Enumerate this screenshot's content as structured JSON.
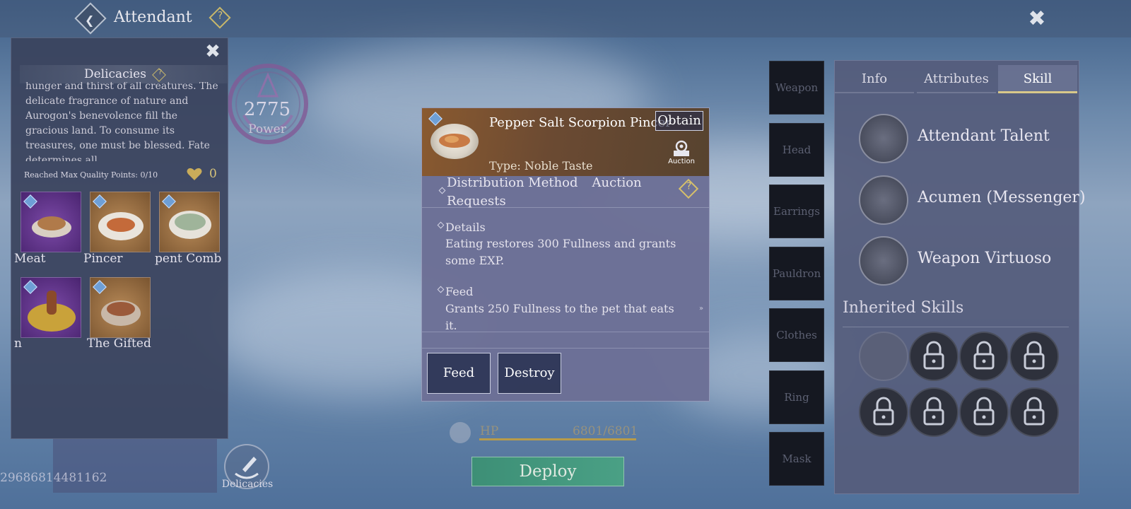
{
  "header": {
    "title": "Attendant",
    "help_symbol": "?"
  },
  "delicacies_panel": {
    "title": "Delicacies",
    "description": "hunger and thirst of all creatures. The delicate fragrance of nature and Aurogon's benevolence fill the gracious land. To consume its treasures, one must be blessed. Fate determines all",
    "quality_text": "Reached Max Quality Points: 0/10",
    "heart_count": "0",
    "items": [
      {
        "label": "Meat",
        "rarity": "purple",
        "icon": "food-icon"
      },
      {
        "label": "Pincer",
        "rarity": "gold",
        "icon": "food-icon"
      },
      {
        "label": "pent Comb",
        "rarity": "gold",
        "icon": "food-icon"
      },
      {
        "label": "n",
        "rarity": "purple",
        "icon": "food-icon"
      },
      {
        "label": "The Gifted",
        "rarity": "gold",
        "icon": "food-icon"
      }
    ]
  },
  "power": {
    "value": "2775",
    "label": "Power"
  },
  "account_id": "29686814481162",
  "delicacies_button_label": "Delicacies",
  "item_popup": {
    "name": "Pepper Salt Scorpion Pincer",
    "obtain_label": "Obtain",
    "type_text": "Type: Noble Taste",
    "auction_label": "Auction",
    "distribution_label": "Distribution Method",
    "distribution_value": "Auction",
    "requests_label": "Requests",
    "details_heading": "Details",
    "details_text": "Eating restores 300 Fullness and grants some EXP.",
    "feed_heading": "Feed",
    "feed_text": "Grants 250 Fullness to the pet that eats it.",
    "scroll_symbol": "»",
    "feed_button": "Feed",
    "destroy_button": "Destroy"
  },
  "equipment_slots": [
    "Weapon",
    "Head",
    "Earrings",
    "Pauldron",
    "Clothes",
    "Ring",
    "Mask"
  ],
  "right_panel": {
    "tabs": [
      {
        "label": "Info",
        "active": false
      },
      {
        "label": "Attributes",
        "active": false
      },
      {
        "label": "Skill",
        "active": true
      }
    ],
    "skills": [
      "Attendant Talent",
      "Acumen (Messenger)",
      "Weapon Virtuoso"
    ],
    "inherited_title": "Inherited Skills",
    "inherited_slots": [
      "empty",
      "locked",
      "locked",
      "locked",
      "locked",
      "locked",
      "locked",
      "locked"
    ]
  },
  "hp": {
    "label": "HP",
    "value": "6801/6801",
    "fill": 1.0
  },
  "deploy_label": "Deploy",
  "colors": {
    "accent_gold": "#d8c88a",
    "deploy_green": "#4aa085"
  }
}
